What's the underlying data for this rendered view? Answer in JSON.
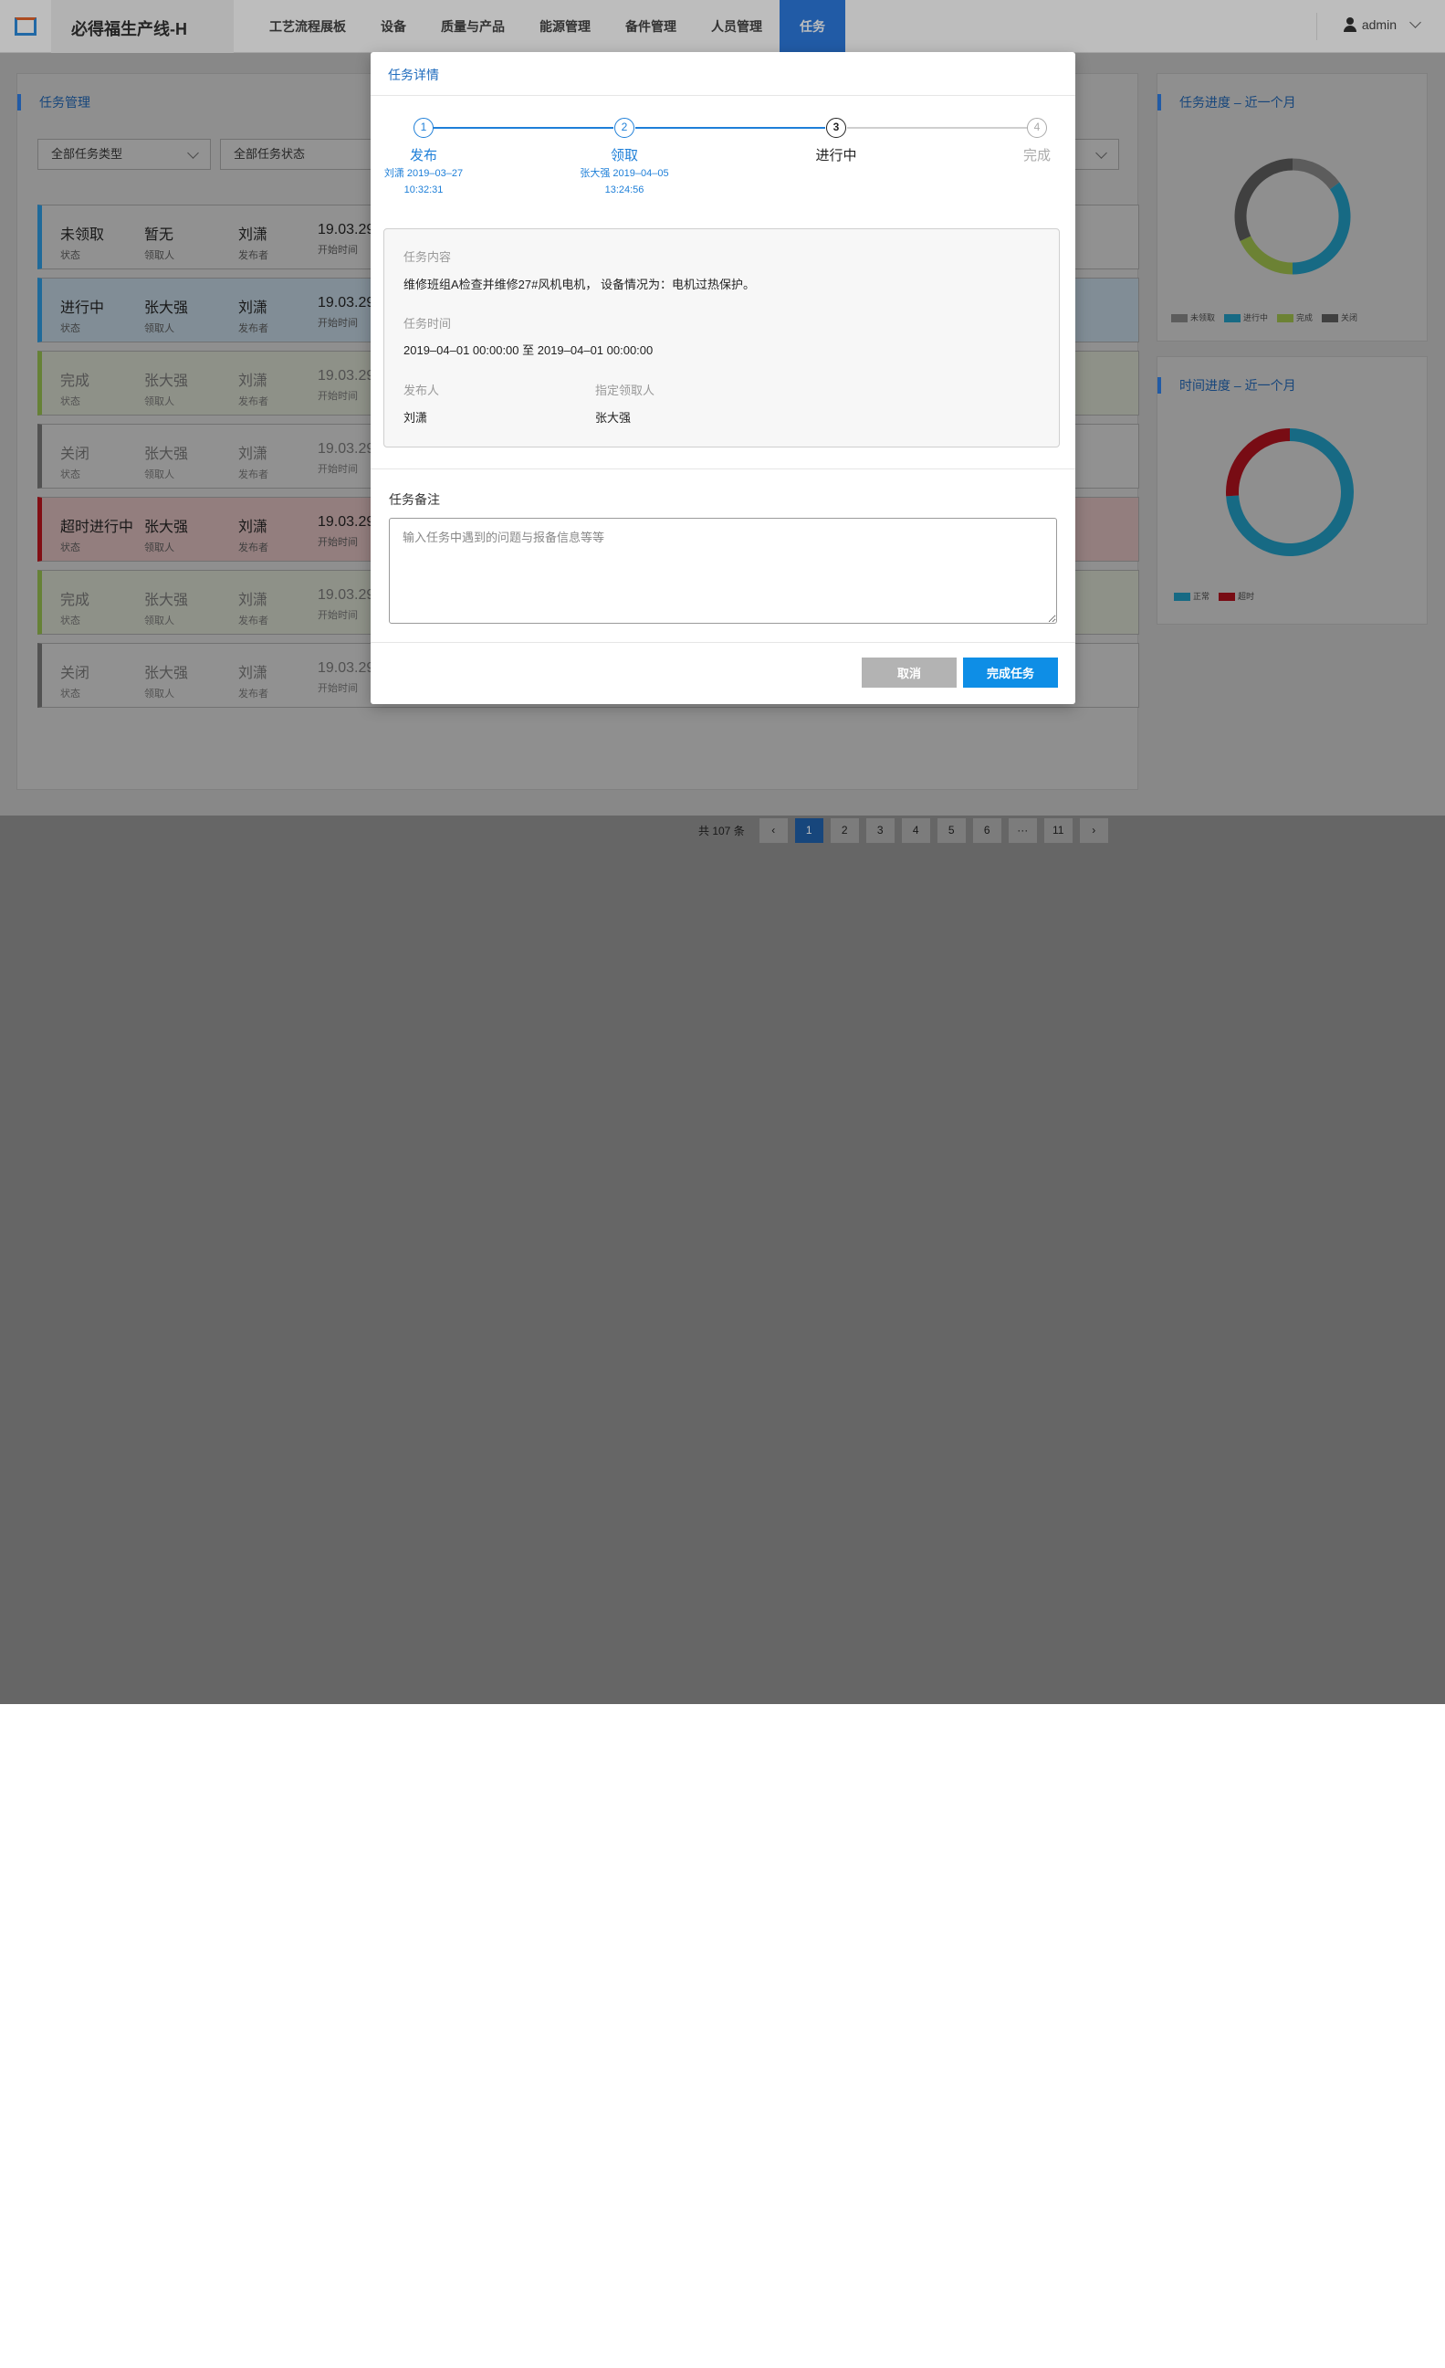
{
  "app": {
    "brand": "必得福生产线-H"
  },
  "nav": [
    {
      "label": "工艺流程展板",
      "active": false
    },
    {
      "label": "设备",
      "active": false
    },
    {
      "label": "质量与产品",
      "active": false
    },
    {
      "label": "能源管理",
      "active": false
    },
    {
      "label": "备件管理",
      "active": false
    },
    {
      "label": "人员管理",
      "active": false
    },
    {
      "label": "任务",
      "active": true
    }
  ],
  "user": {
    "name": "admin"
  },
  "task_panel": {
    "title": "任务管理",
    "filters": [
      "全部任务类型",
      "全部任务状态"
    ],
    "field_labels": {
      "status": "状态",
      "receiver": "领取人",
      "publisher": "发布者",
      "start": "开始时间"
    },
    "rows": [
      {
        "status": "未领取",
        "receiver": "暂无",
        "publisher": "刘潇",
        "start": "19.03.29",
        "color": "#2a8fd0"
      },
      {
        "status": "进行中",
        "receiver": "张大强",
        "publisher": "刘潇",
        "start": "19.03.29",
        "color": "#2a8fd0"
      },
      {
        "status": "完成",
        "receiver": "张大强",
        "publisher": "刘潇",
        "start": "19.03.29",
        "color": "#8ab04a"
      },
      {
        "status": "关闭",
        "receiver": "张大强",
        "publisher": "刘潇",
        "start": "19.03.29",
        "color": "#6f6f6f"
      },
      {
        "status": "超时进行中",
        "receiver": "张大强",
        "publisher": "刘潇",
        "start": "19.03.29",
        "color": "#b0141c"
      },
      {
        "status": "完成",
        "receiver": "张大强",
        "publisher": "刘潇",
        "start": "19.03.29",
        "color": "#8ab04a"
      },
      {
        "status": "关闭",
        "receiver": "张大强",
        "publisher": "刘潇",
        "start": "19.03.29",
        "color": "#6f6f6f"
      }
    ],
    "pagination": {
      "total_text": "共 107 条",
      "pages": [
        "1",
        "2",
        "3",
        "4",
        "5",
        "6",
        "···",
        "11"
      ],
      "current": "1"
    }
  },
  "progress_chart": {
    "title": "任务进度 – 近一个月",
    "chart_data": {
      "type": "pie",
      "categories": [
        "未领取",
        "进行中",
        "完成",
        "关闭"
      ],
      "values": [
        15,
        35,
        18,
        32
      ],
      "colors": [
        "#7d7d7d",
        "#1f8fb3",
        "#92b047",
        "#575757"
      ],
      "legend": "bottom-left"
    }
  },
  "time_chart": {
    "title": "时间进度 – 近一个月",
    "chart_data": {
      "type": "pie",
      "categories": [
        "正常",
        "超时"
      ],
      "values": [
        74,
        26
      ],
      "colors": [
        "#1f8fb3",
        "#a3111c"
      ],
      "legend": "bottom-left"
    }
  },
  "modal": {
    "title": "任务详情",
    "steps": [
      {
        "num": "1",
        "label": "发布",
        "meta1": "刘潇 2019–03–27",
        "meta2": "10:32:31",
        "state": "done"
      },
      {
        "num": "2",
        "label": "领取",
        "meta1": "张大强 2019–04–05",
        "meta2": "13:24:56",
        "state": "done"
      },
      {
        "num": "3",
        "label": "进行中",
        "meta1": "",
        "meta2": "",
        "state": "current"
      },
      {
        "num": "4",
        "label": "完成",
        "meta1": "",
        "meta2": "",
        "state": "pending"
      }
    ],
    "content_label": "任务内容",
    "content_value": "维修班组A检查并维修27#风机电机， 设备情况为：电机过热保护。",
    "time_label": "任务时间",
    "time_value": "2019–04–01 00:00:00 至 2019–04–01 00:00:00",
    "publisher_label": "发布人",
    "publisher_value": "刘潇",
    "assignee_label": "指定领取人",
    "assignee_value": "张大强",
    "remark_label": "任务备注",
    "remark_placeholder": "输入任务中遇到的问题与报备信息等等",
    "cancel_label": "取消",
    "complete_label": "完成任务"
  }
}
